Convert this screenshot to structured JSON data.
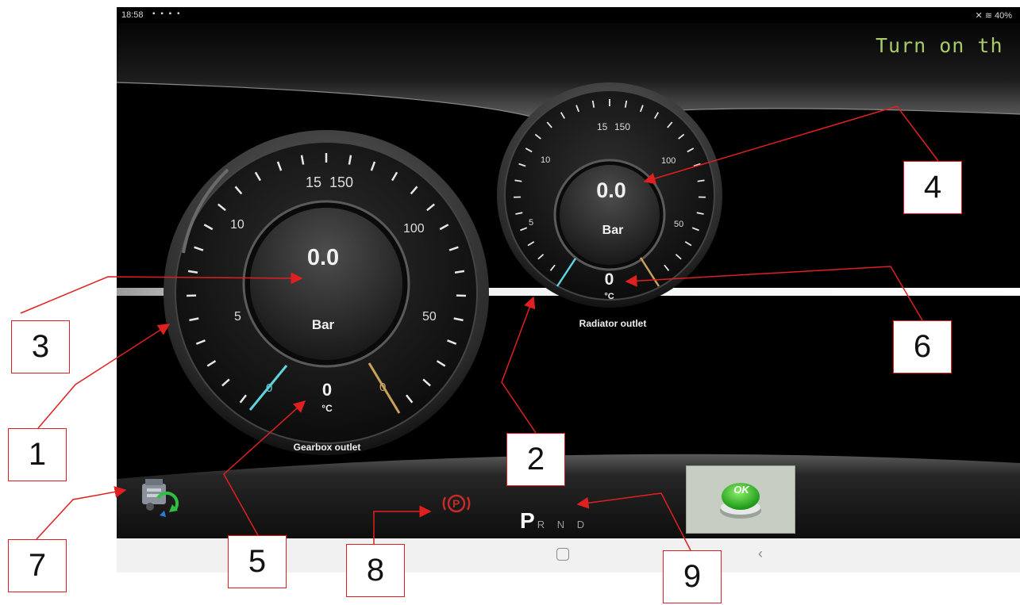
{
  "status_bar": {
    "time": "18:58",
    "notification_icons": "▪ ▪ ▪ •",
    "right": "✕ ≋ 40%"
  },
  "marquee_text": "Turn on th",
  "gearbox_gauge": {
    "name": "Gearbox outlet",
    "pressure_value": "0.0",
    "pressure_unit": "Bar",
    "temperature_value": "0",
    "temperature_unit": "°C",
    "pressure_scale_labels": [
      "5",
      "10",
      "15"
    ],
    "temperature_scale_labels": [
      "150",
      "100",
      "50"
    ],
    "needle_pressure_label": "0",
    "needle_temperature_label": "0"
  },
  "radiator_gauge": {
    "name": "Radiator outlet",
    "pressure_value": "0.0",
    "pressure_unit": "Bar",
    "temperature_value": "0",
    "temperature_unit": "°C",
    "pressure_scale_labels": [
      "5",
      "10",
      "15"
    ],
    "temperature_scale_labels": [
      "150",
      "100",
      "50"
    ]
  },
  "gear_selector": {
    "active": "P",
    "others": "R N D"
  },
  "ok_button": {
    "label": "OK"
  },
  "icons": {
    "engine": "engine-refresh-icon",
    "parking_brake": "parking-brake-icon",
    "parking_brake_symbol": "P",
    "nav_home": "home-icon",
    "nav_back": "back-icon"
  },
  "callouts": [
    "1",
    "2",
    "3",
    "4",
    "5",
    "6",
    "7",
    "8",
    "9"
  ],
  "colors": {
    "annotation_red": "#e02020",
    "marquee": "#a9c96a",
    "needle_cyan": "#5fd4dd",
    "needle_gold": "#c9a25a"
  }
}
